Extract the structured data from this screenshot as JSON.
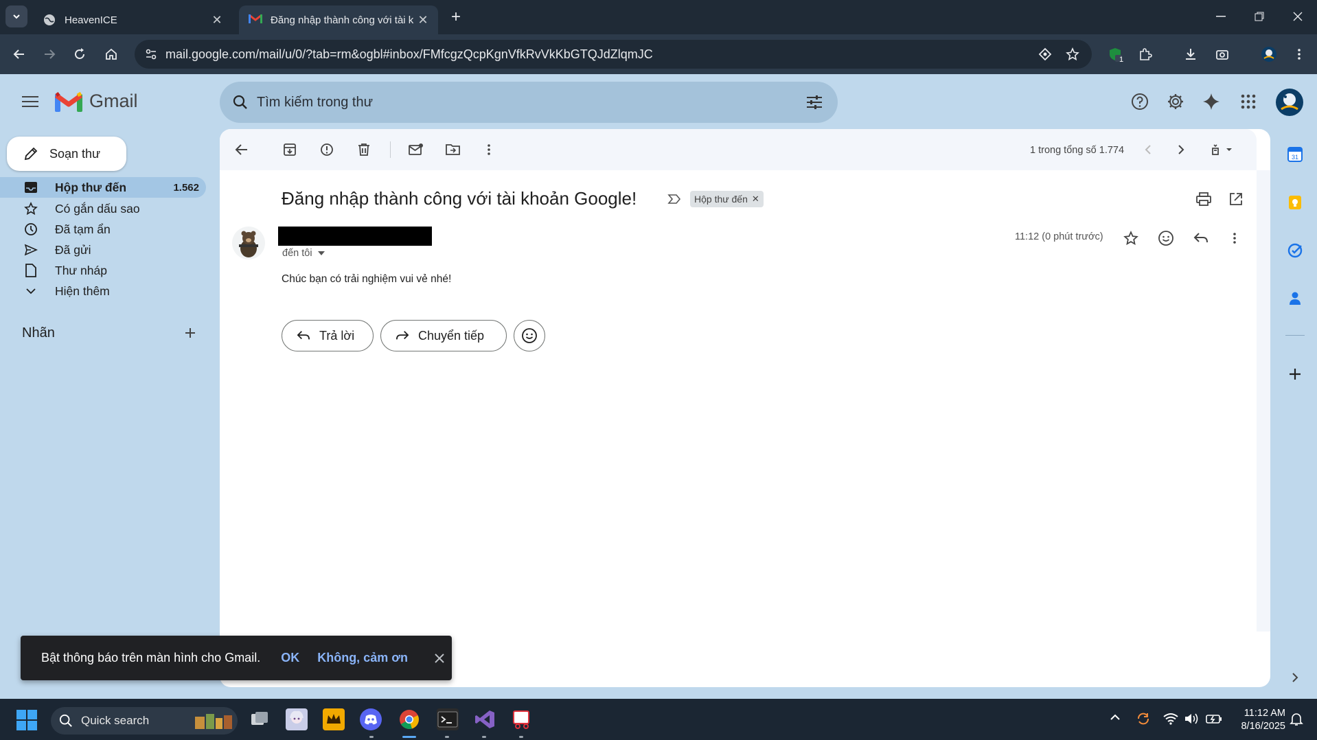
{
  "browser": {
    "tabs": [
      {
        "label": "HeavenICE",
        "active": false
      },
      {
        "label": "Đăng nhập thành công với tài k",
        "active": true
      }
    ],
    "url": "mail.google.com/mail/u/0/?tab=rm&ogbl#inbox/FMfcgzQcpKgnVfkRvVkKbGTQJdZlqmJC",
    "extension_badge": "1"
  },
  "gmail": {
    "logo_text": "Gmail",
    "search_placeholder": "Tìm kiếm trong thư",
    "compose_label": "Soạn thư",
    "nav": [
      {
        "label": "Hộp thư đến",
        "count": "1.562",
        "icon": "inbox-icon"
      },
      {
        "label": "Có gắn dấu sao",
        "icon": "star-icon"
      },
      {
        "label": "Đã tạm ẩn",
        "icon": "clock-icon"
      },
      {
        "label": "Đã gửi",
        "icon": "send-icon"
      },
      {
        "label": "Thư nháp",
        "icon": "draft-icon"
      },
      {
        "label": "Hiện thêm",
        "icon": "chevron-down-icon"
      }
    ],
    "labels_heading": "Nhãn"
  },
  "message": {
    "pagination": "1 trong tổng số 1.774",
    "subject": "Đăng nhập thành công với tài khoản Google!",
    "label_chip": "Hộp thư đến",
    "to": "đến tôi",
    "time": "11:12 (0 phút trước)",
    "body": "Chúc bạn có trải nghiệm vui vẻ nhé!",
    "reply_label": "Trả lời",
    "forward_label": "Chuyển tiếp"
  },
  "snackbar": {
    "message": "Bật thông báo trên màn hình cho Gmail.",
    "ok": "OK",
    "decline": "Không, cảm ơn"
  },
  "taskbar": {
    "search_label": "Quick search",
    "time": "11:12 AM",
    "date": "8/16/2025"
  },
  "colors": {
    "page_bg": "#bfd8ec",
    "browser_dark": "#1f2a36",
    "selected_nav": "#a3c6e4",
    "snackbar_bg": "#202124",
    "snackbar_action": "#8ab4f8"
  }
}
